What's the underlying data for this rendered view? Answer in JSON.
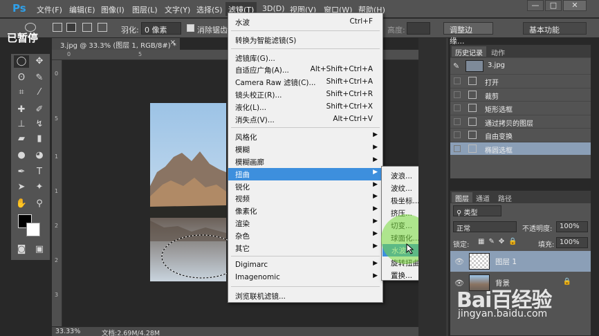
{
  "app": {
    "logo": "Ps",
    "paused_label": "已暂停"
  },
  "menubar": {
    "items": [
      "文件(F)",
      "编辑(E)",
      "图像(I)",
      "图层(L)",
      "文字(Y)",
      "选择(S)",
      "滤镜(T)",
      "3D(D)",
      "视图(V)",
      "窗口(W)",
      "帮助(H)"
    ],
    "active": "滤镜(T)",
    "window_buttons": [
      "—",
      "□",
      "✕"
    ]
  },
  "options": {
    "feather_label": "羽化:",
    "feather_value": "0 像素",
    "antialias_label": "消除锯齿",
    "height_label": "高度:",
    "refine_edge": "调整边缘...",
    "workspace": "基本功能"
  },
  "document": {
    "tab_title": "3.jpg @ 33.3% (图层 1, RGB/8#) *",
    "ruler_top": [
      "0",
      "5"
    ],
    "ruler_left": [
      "0",
      "5",
      "1",
      "1",
      "2",
      "2",
      "3"
    ],
    "zoom": "33.33%",
    "doc_info": "文档:2.69M/4.28M"
  },
  "filter_menu": {
    "items": [
      {
        "label": "水波",
        "shortcut": "Ctrl+F"
      },
      {
        "sep": true
      },
      {
        "label": "转换为智能滤镜(S)"
      },
      {
        "sep": true
      },
      {
        "label": "滤镜库(G)..."
      },
      {
        "label": "自适应广角(A)...",
        "shortcut": "Alt+Shift+Ctrl+A"
      },
      {
        "label": "Camera Raw 滤镜(C)...",
        "shortcut": "Shift+Ctrl+A"
      },
      {
        "label": "镜头校正(R)...",
        "shortcut": "Shift+Ctrl+R"
      },
      {
        "label": "液化(L)...",
        "shortcut": "Shift+Ctrl+X"
      },
      {
        "label": "消失点(V)...",
        "shortcut": "Alt+Ctrl+V"
      },
      {
        "sep": true
      },
      {
        "label": "风格化",
        "sub": true
      },
      {
        "label": "模糊",
        "sub": true
      },
      {
        "label": "模糊画廊",
        "sub": true
      },
      {
        "label": "扭曲",
        "sub": true,
        "highlighted": true
      },
      {
        "label": "锐化",
        "sub": true
      },
      {
        "label": "视频",
        "sub": true
      },
      {
        "label": "像素化",
        "sub": true
      },
      {
        "label": "渲染",
        "sub": true
      },
      {
        "label": "杂色",
        "sub": true
      },
      {
        "label": "其它",
        "sub": true
      },
      {
        "sep": true
      },
      {
        "label": "Digimarc",
        "sub": true
      },
      {
        "label": "Imagenomic",
        "sub": true
      },
      {
        "sep": true
      },
      {
        "label": "浏览联机滤镜..."
      }
    ]
  },
  "distort_submenu": {
    "items": [
      "波浪...",
      "波纹...",
      "极坐标...",
      "挤压...",
      "切变...",
      "球面化...",
      "水波...",
      "旋转扭曲...",
      "置换..."
    ],
    "highlighted": "水波..."
  },
  "history_panel": {
    "tabs": [
      "历史记录",
      "动作"
    ],
    "snapshot": "3.jpg",
    "items": [
      "打开",
      "裁剪",
      "矩形选框",
      "通过拷贝的图层",
      "自由变换",
      "椭圆选框"
    ],
    "selected": "椭圆选框"
  },
  "layers_panel": {
    "tabs": [
      "图层",
      "通道",
      "路径"
    ],
    "kind_filter": "类型",
    "blend_mode": "正常",
    "opacity_label": "不透明度:",
    "opacity_value": "100%",
    "lock_label": "锁定:",
    "fill_label": "填充:",
    "fill_value": "100%",
    "layers": [
      {
        "name": "图层 1",
        "selected": true
      },
      {
        "name": "背景",
        "locked": true
      }
    ]
  },
  "watermark": {
    "logo": "Bai百经验",
    "url": "jingyan.baidu.com"
  },
  "colors": {
    "ps_blue": "#2fa0ea",
    "menu_highlight": "#3d8fdd",
    "panel_select": "#8b9fb7",
    "cursor_circle": "#78dc3c"
  }
}
